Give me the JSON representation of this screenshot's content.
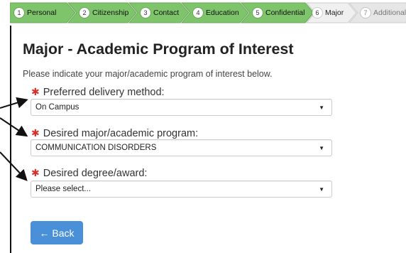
{
  "steps": [
    {
      "num": "1",
      "label": "Personal",
      "state": "done"
    },
    {
      "num": "2",
      "label": "Citizenship",
      "state": "done"
    },
    {
      "num": "3",
      "label": "Contact",
      "state": "done"
    },
    {
      "num": "4",
      "label": "Education",
      "state": "done"
    },
    {
      "num": "5",
      "label": "Confidential",
      "state": "done"
    },
    {
      "num": "6",
      "label": "Major",
      "state": "current"
    },
    {
      "num": "7",
      "label": "Additional",
      "state": "future"
    }
  ],
  "colors": {
    "done": "#7dc46a",
    "current": "#f0f0f0",
    "future": "#e6e6e6",
    "required": "#d9302c",
    "button": "#4a90d9"
  },
  "page": {
    "title": "Major - Academic Program of Interest",
    "intro": "Please indicate your major/academic program of interest below."
  },
  "fields": [
    {
      "label": "Preferred delivery method:",
      "value": "On Campus"
    },
    {
      "label": "Desired major/academic program:",
      "value": "COMMUNICATION DISORDERS"
    },
    {
      "label": "Desired degree/award:",
      "value": "Please select..."
    }
  ],
  "required_mark": "✱",
  "back_button": "← Back"
}
